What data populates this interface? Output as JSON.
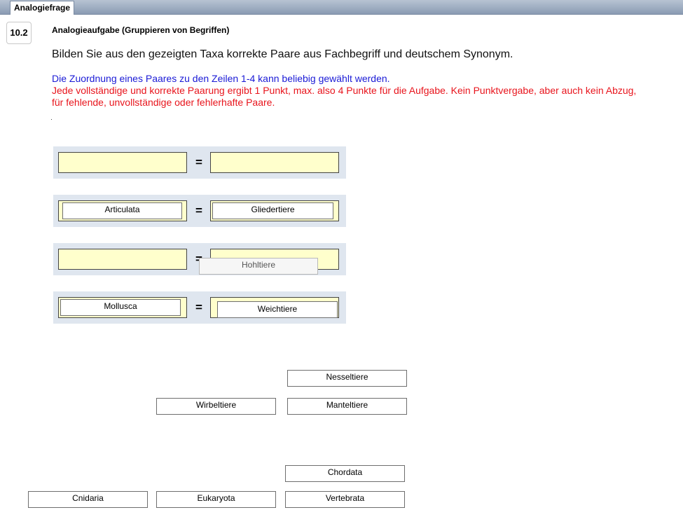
{
  "tab": {
    "label": "Analogiefrage"
  },
  "question": {
    "number": "10.2",
    "title": "Analogieaufgabe (Gruppieren von Begriffen)",
    "prompt": "Bilden Sie aus den gezeigten Taxa korrekte Paare aus Fachbegriff und deutschem Synonym.",
    "note_blue": "Die Zuordnung eines Paares zu den Zeilen 1-4 kann beliebig gewählt werden.",
    "note_red": "Jede vollständige und korrekte Paarung ergibt 1 Punkt, max. also 4 Punkte für die Aufgabe. Kein Punktvergabe, aber auch kein Abzug, für fehlende, unvollständige oder fehlerhafte Paare."
  },
  "equals": "=",
  "rows": [
    {
      "left": "",
      "right": ""
    },
    {
      "left": "Articulata",
      "right": "Gliedertiere"
    },
    {
      "left": "",
      "right": ""
    },
    {
      "left": "Mollusca",
      "right": "Weichtiere"
    }
  ],
  "dragging": {
    "label": "Hohltiere"
  },
  "pool": [
    "Nesseltiere",
    "Wirbeltiere",
    "Manteltiere",
    "Chordata",
    "Cnidaria",
    "Eukaryota",
    "Vertebrata"
  ]
}
